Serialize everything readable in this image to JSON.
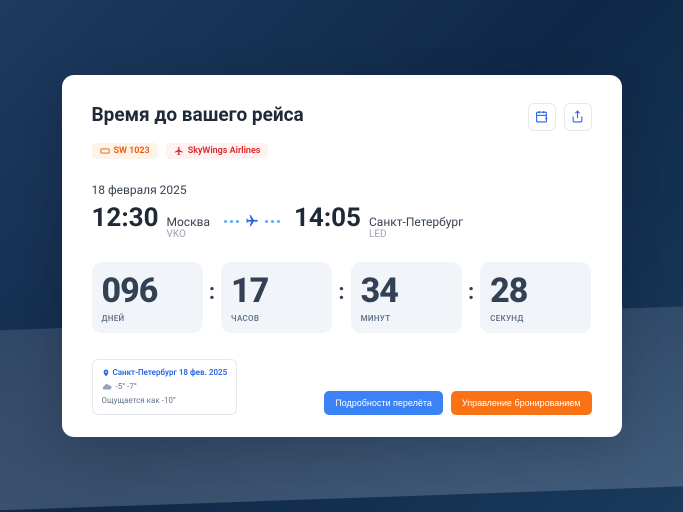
{
  "title": "Время до вашего рейса",
  "flight_number": "SW 1023",
  "airline": "SkyWings Airlines",
  "date": "18 февраля 2025",
  "departure": {
    "time": "12:30",
    "city": "Москва",
    "code": "VKO"
  },
  "arrival": {
    "time": "14:05",
    "city": "Санкт-Петербург",
    "code": "LED"
  },
  "countdown": {
    "days": {
      "value": "096",
      "label": "ДНЕЙ"
    },
    "hours": {
      "value": "17",
      "label": "ЧАСОВ"
    },
    "minutes": {
      "value": "34",
      "label": "МИНУТ"
    },
    "seconds": {
      "value": "28",
      "label": "СЕКУНД"
    }
  },
  "weather": {
    "location": "Санкт-Петербург 18 фев. 2025",
    "temp": "-5° -7°",
    "feels": "Ощущается как -10°"
  },
  "buttons": {
    "details": "Подробности перелёта",
    "manage": "Управление бронированием"
  }
}
